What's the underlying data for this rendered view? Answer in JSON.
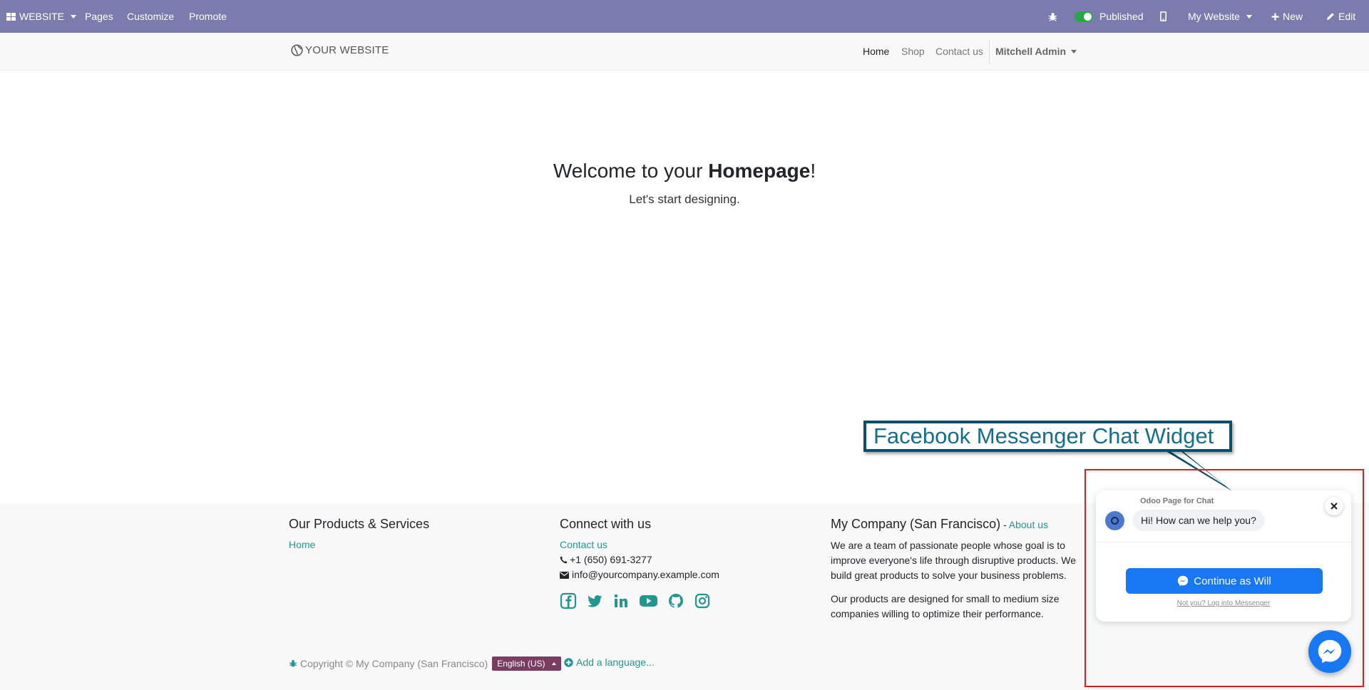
{
  "admin_bar": {
    "app_menu": "WEBSITE",
    "menu": [
      "Pages",
      "Customize",
      "Promote"
    ],
    "published_label": "Published",
    "website_selector": "My Website",
    "new_label": "New",
    "edit_label": "Edit"
  },
  "header": {
    "logo_text": "YOUR WEBSITE",
    "nav": [
      "Home",
      "Shop",
      "Contact us"
    ],
    "user": "Mitchell Admin"
  },
  "hero": {
    "title_prefix": "Welcome to your ",
    "title_bold": "Homepage",
    "title_suffix": "!",
    "subtitle": "Let's start designing."
  },
  "footer": {
    "col1": {
      "title": "Our Products & Services",
      "link": "Home"
    },
    "col2": {
      "title": "Connect with us",
      "contact_link": "Contact us",
      "phone": "+1 (650) 691-3277",
      "email": "info@yourcompany.example.com",
      "social_icons": [
        "facebook-icon",
        "twitter-icon",
        "linkedin-icon",
        "youtube-icon",
        "github-icon",
        "instagram-icon"
      ]
    },
    "col3": {
      "title": "My Company (San Francisco)",
      "title_sep": " - ",
      "about_link": "About us",
      "para1": "We are a team of passionate people whose goal is to improve everyone's life through disruptive products. We build great products to solve your business problems.",
      "para2": "Our products are designed for small to medium size companies willing to optimize their performance."
    },
    "copyright": "Copyright © My Company (San Francisco)",
    "language": "English (US)",
    "add_language": "Add a language..."
  },
  "annotation": {
    "label": "Facebook Messenger Chat Widget",
    "frame_color": "#d62020",
    "callout_text_color": "#146e8c"
  },
  "messenger": {
    "page_name": "Odoo Page for Chat",
    "greeting": "Hi! How can we help you?",
    "continue_label": "Continue as Will",
    "not_you": "Not you? Log into Messenger"
  },
  "colors": {
    "admin_bar": "#7c7bad",
    "link": "#23968f",
    "language_button": "#7a3c61",
    "messenger_blue": "#1877f2"
  }
}
